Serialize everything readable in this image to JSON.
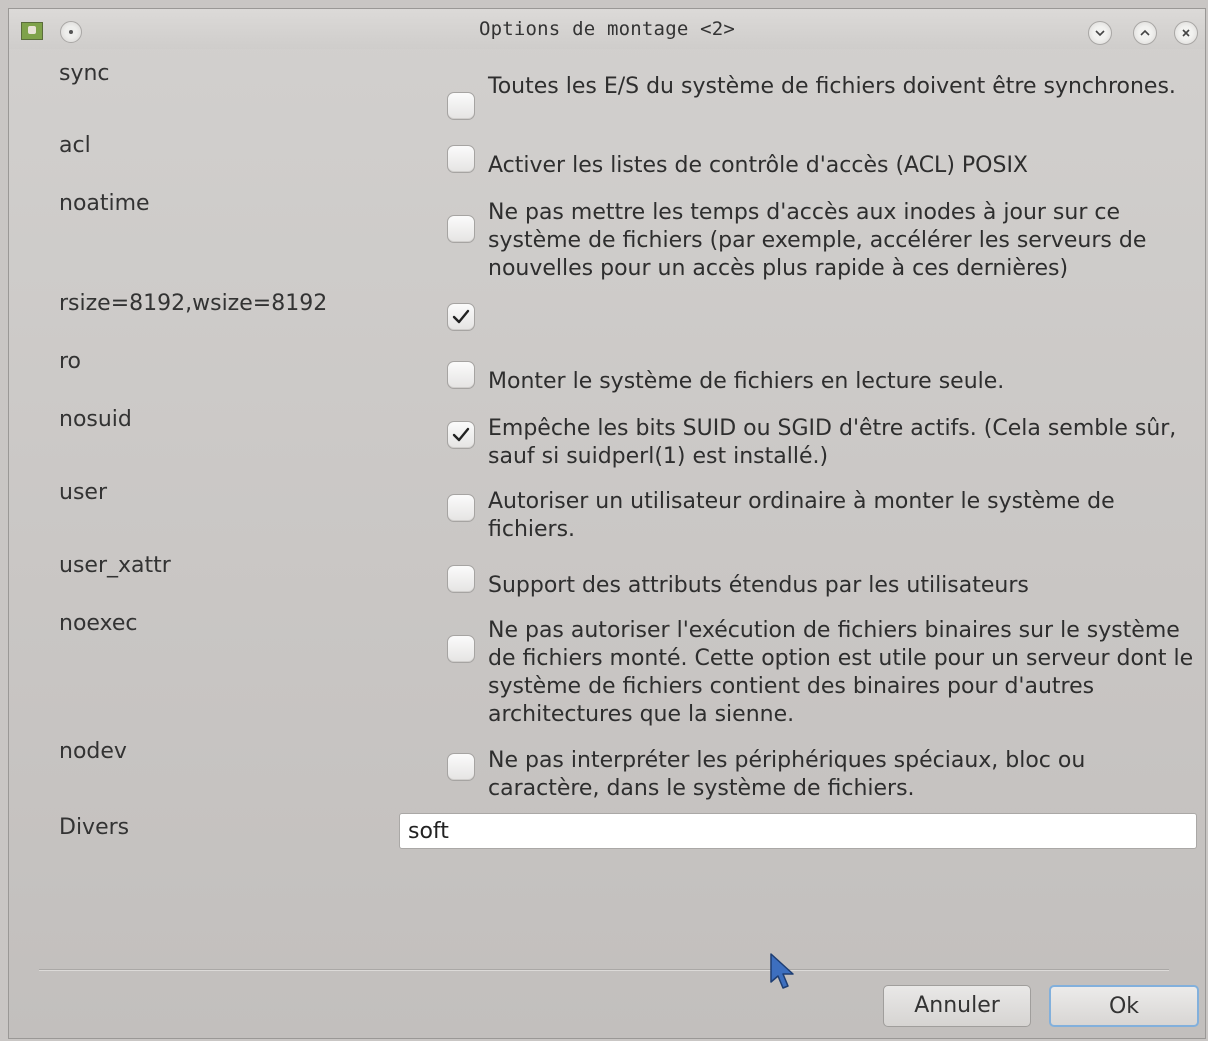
{
  "window": {
    "title": "Options de montage <2>"
  },
  "options": [
    {
      "name": "sync",
      "checked": false,
      "description": "Toutes les E/S du système de fichiers doivent être synchrones."
    },
    {
      "name": "acl",
      "checked": false,
      "description": "Activer les listes de contrôle d'accès (ACL) POSIX"
    },
    {
      "name": "noatime",
      "checked": false,
      "description": "Ne pas mettre les temps d'accès aux inodes à jour sur ce système de fichiers (par exemple, accélérer les serveurs de nouvelles pour un accès plus rapide à ces dernières)"
    },
    {
      "name": "rsize=8192,wsize=8192",
      "checked": true,
      "description": ""
    },
    {
      "name": "ro",
      "checked": false,
      "description": "Monter le système de fichiers en lecture seule."
    },
    {
      "name": "nosuid",
      "checked": true,
      "description": "Empêche les bits SUID ou SGID d'être actifs. (Cela semble sûr, sauf si suidperl(1) est installé.)"
    },
    {
      "name": "user",
      "checked": false,
      "description": "Autoriser un utilisateur ordinaire à monter le système de fichiers."
    },
    {
      "name": "user_xattr",
      "checked": false,
      "description": "Support des attributs étendus par les utilisateurs"
    },
    {
      "name": "noexec",
      "checked": false,
      "description": "Ne pas autoriser l'exécution de fichiers binaires sur le système de fichiers monté. Cette option est utile pour un serveur dont le système de fichiers contient des binaires pour d'autres architectures que la sienne."
    },
    {
      "name": "nodev",
      "checked": false,
      "description": "Ne pas interpréter les périphériques spéciaux, bloc ou caractère, dans le système de fichiers."
    }
  ],
  "divers": {
    "label": "Divers",
    "value": "soft"
  },
  "buttons": {
    "cancel": "Annuler",
    "ok": "Ok"
  },
  "colors": {
    "window_bg": "#c9c6c4",
    "focus_border": "#82b0dc"
  }
}
